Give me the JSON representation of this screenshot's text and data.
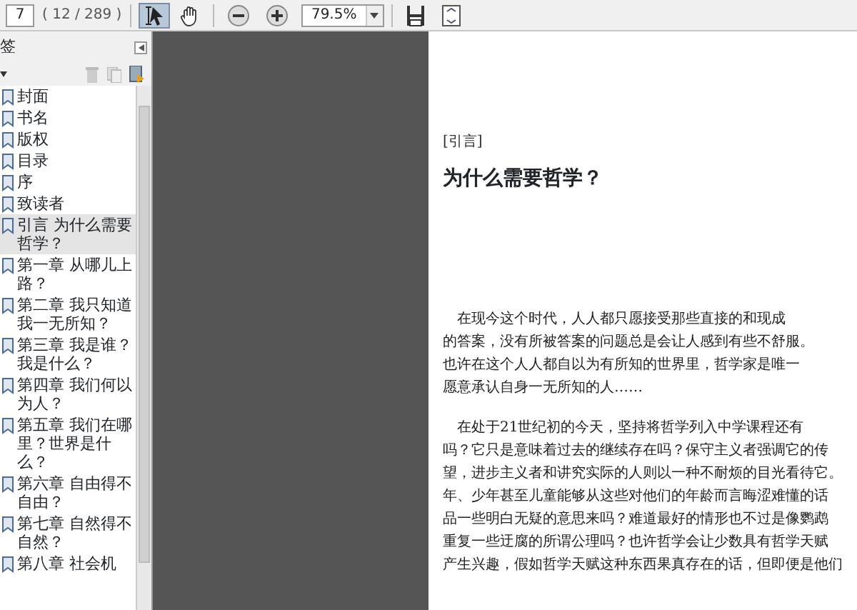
{
  "toolbar": {
    "page_number": "7",
    "page_count": "( 12 / 289 )",
    "zoom": "79.5%",
    "tools": [
      {
        "kind": "select",
        "selected": true
      },
      {
        "kind": "hand",
        "selected": false
      }
    ]
  },
  "sidebar": {
    "title": "签",
    "bookmarks": [
      {
        "label": "封面",
        "selected": false
      },
      {
        "label": "书名",
        "selected": false
      },
      {
        "label": "版权",
        "selected": false
      },
      {
        "label": "目录",
        "selected": false
      },
      {
        "label": "序",
        "selected": false
      },
      {
        "label": "致读者",
        "selected": false
      },
      {
        "label": "引言 为什么需要哲学？",
        "selected": true
      },
      {
        "label": "第一章 从哪儿上路？",
        "selected": false
      },
      {
        "label": "第二章 我只知道我一无所知？",
        "selected": false
      },
      {
        "label": "第三章 我是谁？我是什么？",
        "selected": false
      },
      {
        "label": "第四章 我们何以为人？",
        "selected": false
      },
      {
        "label": "第五章 我们在哪里？世界是什么？",
        "selected": false
      },
      {
        "label": "第六章 自由得不自由？",
        "selected": false
      },
      {
        "label": "第七章 自然得不自然？",
        "selected": false
      },
      {
        "label": "第八章 社会机",
        "selected": false
      }
    ]
  },
  "page": {
    "section_label": "[引言]",
    "heading": "为什么需要哲学？",
    "epigraph": [
      "在现今这个时代，人人都只愿接受那些直接的和现成",
      "的答案，没有所被答案的问题总是会让人感到有些不舒服。",
      "也许在这个人人都自以为有所知的世界里，哲学家是唯一",
      "愿意承认自身一无所知的人……"
    ],
    "body": [
      "在处于21世纪初的今天，坚持将哲学列入中学课程还有",
      "吗？它只是意味着过去的继续存在吗？保守主义者强调它的传",
      "望，进步主义者和讲究实际的人则以一种不耐烦的目光看待它。",
      "年、少年甚至儿童能够从这些对他们的年龄而言晦涩难懂的话",
      "品一些明白无疑的意思来吗？难道最好的情形也不过是像鹦鹉",
      "重复一些迂腐的所谓公理吗？也许哲学会让少数具有哲学天赋",
      "产生兴趣，假如哲学天赋这种东西果真存在的话，但即便是他们"
    ]
  }
}
